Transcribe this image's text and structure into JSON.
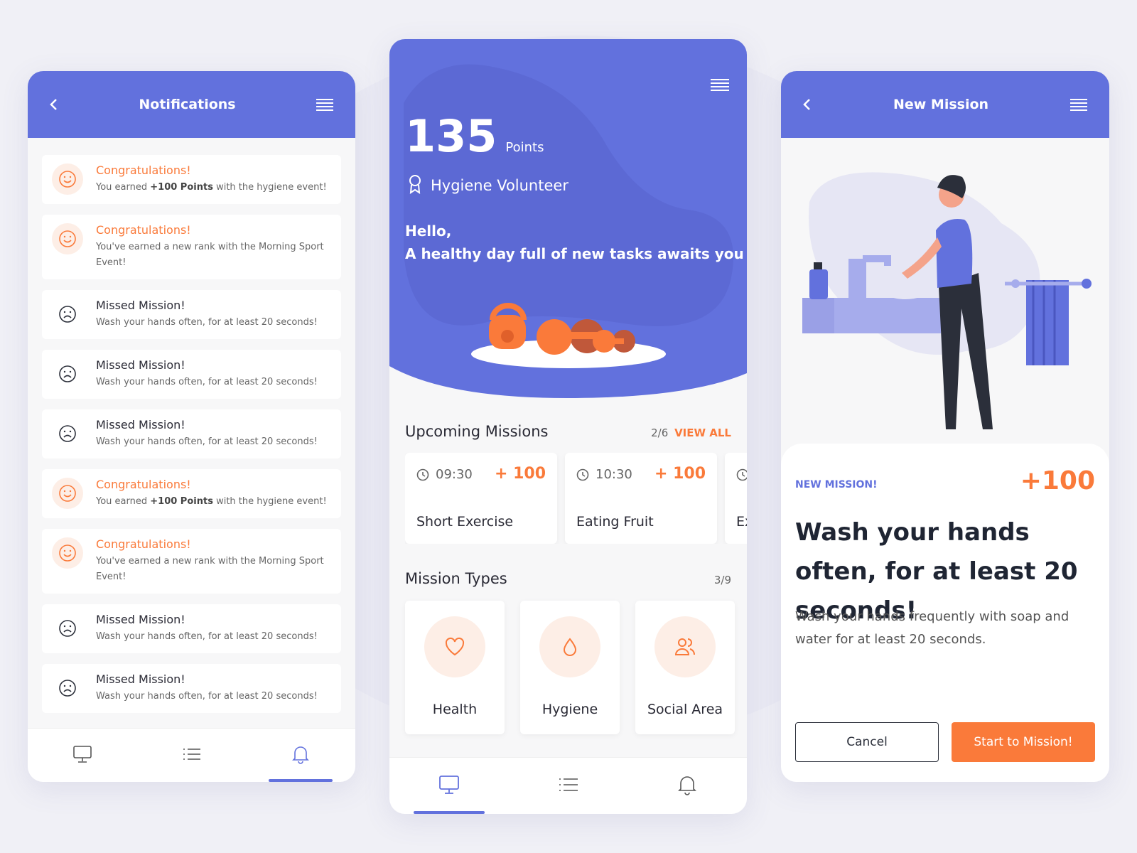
{
  "colors": {
    "primary": "#6271dd",
    "accent": "#fa7a3a",
    "background": "#f0f0f6"
  },
  "notifications": {
    "title": "Notifications",
    "items": [
      {
        "type": "happy",
        "title": "Congratulations!",
        "pre": "You earned ",
        "bold": "+100 Points",
        "post": " with the hygiene event!"
      },
      {
        "type": "happy",
        "title": "Congratulations!",
        "pre": "You've earned a new rank with the Morning Sport Event!",
        "bold": "",
        "post": ""
      },
      {
        "type": "sad",
        "title": "Missed Mission!",
        "pre": "Wash your hands often, for at least 20 seconds!",
        "bold": "",
        "post": ""
      },
      {
        "type": "sad",
        "title": "Missed Mission!",
        "pre": "Wash your hands often, for at least 20 seconds!",
        "bold": "",
        "post": ""
      },
      {
        "type": "sad",
        "title": "Missed Mission!",
        "pre": "Wash your hands often, for at least 20 seconds!",
        "bold": "",
        "post": ""
      },
      {
        "type": "happy",
        "title": "Congratulations!",
        "pre": "You earned ",
        "bold": "+100 Points",
        "post": " with the hygiene event!"
      },
      {
        "type": "happy",
        "title": "Congratulations!",
        "pre": "You've earned a new rank with the Morning Sport Event!",
        "bold": "",
        "post": ""
      },
      {
        "type": "sad",
        "title": "Missed Mission!",
        "pre": "Wash your hands often, for at least 20 seconds!",
        "bold": "",
        "post": ""
      },
      {
        "type": "sad",
        "title": "Missed Mission!",
        "pre": "Wash your hands often, for at least 20 seconds!",
        "bold": "",
        "post": ""
      }
    ],
    "active_tab": "notifications"
  },
  "home": {
    "points": "135",
    "points_label": "Points",
    "rank": "Hygiene Volunteer",
    "greeting": "Hello,",
    "subtitle": "A healthy day full of new tasks awaits you",
    "upcoming_title": "Upcoming Missions",
    "upcoming_count": "2/6",
    "view_all": "VIEW ALL",
    "missions": [
      {
        "time": "09:30",
        "points": "+ 100",
        "name": "Short Exercise"
      },
      {
        "time": "10:30",
        "points": "+ 100",
        "name": "Eating Fruit"
      },
      {
        "time": "",
        "points": "",
        "name": "Ex"
      }
    ],
    "types_title": "Mission Types",
    "types_count": "3/9",
    "types": [
      {
        "label": "Health",
        "icon": "heart-icon"
      },
      {
        "label": "Hygiene",
        "icon": "drop-icon"
      },
      {
        "label": "Social Area",
        "icon": "people-icon"
      }
    ],
    "active_tab": "dashboard"
  },
  "mission": {
    "title": "New Mission",
    "tag": "NEW MISSION!",
    "points": "+100",
    "heading": "Wash your hands often, for at least 20 seconds!",
    "description": "Wash your hands frequently with soap and water for at least 20 seconds.",
    "cancel": "Cancel",
    "start": "Start to Mission!"
  }
}
